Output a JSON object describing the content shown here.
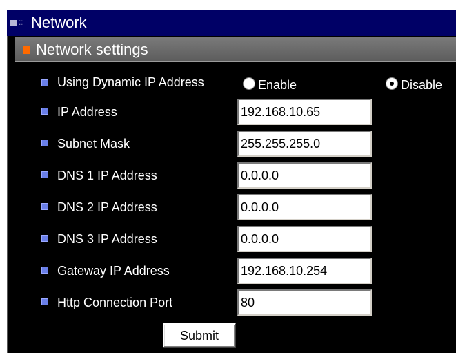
{
  "window": {
    "title": "Network"
  },
  "section": {
    "title": "Network settings"
  },
  "dynamic_ip": {
    "label": "Using Dynamic IP Address",
    "options": [
      {
        "label": "Enable",
        "checked": false
      },
      {
        "label": "Disable",
        "checked": true
      }
    ]
  },
  "fields": [
    {
      "label": "IP Address",
      "value": "192.168.10.65"
    },
    {
      "label": "Subnet Mask",
      "value": "255.255.255.0"
    },
    {
      "label": "DNS 1 IP Address",
      "value": "0.0.0.0"
    },
    {
      "label": "DNS 2 IP Address",
      "value": "0.0.0.0"
    },
    {
      "label": "DNS 3 IP Address",
      "value": "0.0.0.0"
    },
    {
      "label": "Gateway IP Address",
      "value": "192.168.10.254"
    },
    {
      "label": "Http Connection Port",
      "value": "80"
    }
  ],
  "submit_label": "Submit",
  "colors": {
    "title_bar": "#000066",
    "panel_background": "#000000",
    "section_header": "#6a6a6a",
    "section_icon": "#ff6a00",
    "bullet": "#6a7fe8"
  }
}
